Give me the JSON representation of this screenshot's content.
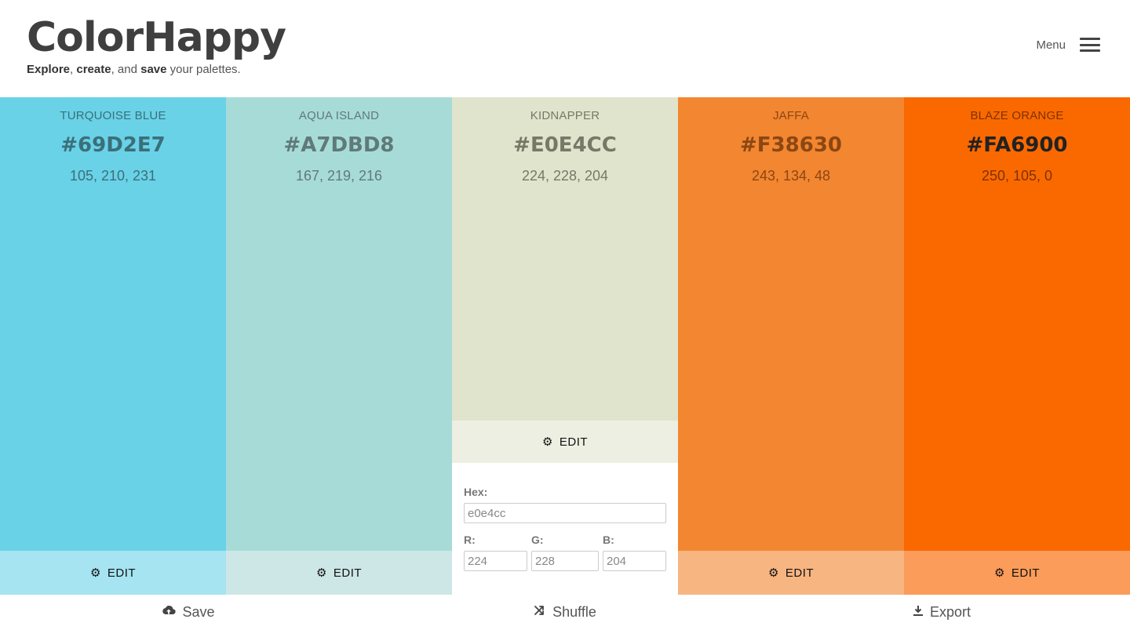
{
  "header": {
    "logo": "ColorHappy",
    "tagline": {
      "w1": "Explore",
      "s1": ", ",
      "w2": "create",
      "s2": ", and ",
      "w3": "save",
      "s3": " your palettes."
    },
    "menu_label": "Menu"
  },
  "edit_label": "EDIT",
  "palette": [
    {
      "name": "TURQUOISE BLUE",
      "hex": "#69D2E7",
      "rgb": "105, 210, 231",
      "bg": "#69D2E7",
      "edit_bg": "#A5E4F0",
      "text": "#3b6f7a",
      "hex_text": "#3b6f7a"
    },
    {
      "name": "AQUA ISLAND",
      "hex": "#A7DBD8",
      "rgb": "167, 219, 216",
      "bg": "#A7DBD8",
      "edit_bg": "#CDE7E6",
      "text": "#5f7a79",
      "hex_text": "#5f7a79"
    },
    {
      "name": "KIDNAPPER",
      "hex": "#E0E4CC",
      "rgb": "224, 228, 204",
      "bg": "#E0E4CC",
      "edit_bg": "#EDEFE2",
      "text": "#777868",
      "hex_text": "#777868"
    },
    {
      "name": "JAFFA",
      "hex": "#F38630",
      "rgb": "243, 134, 48",
      "bg": "#F38630",
      "edit_bg": "#F7B582",
      "text": "#8b4713",
      "hex_text": "#8b4713"
    },
    {
      "name": "BLAZE ORANGE",
      "hex": "#FA6900",
      "rgb": "250, 105, 0",
      "bg": "#FA6900",
      "edit_bg": "#FB9C5A",
      "text": "#7e3200",
      "hex_text": "#222222"
    }
  ],
  "editor": {
    "hex_label": "Hex:",
    "hex_value": "e0e4cc",
    "r_label": "R:",
    "r_value": "224",
    "g_label": "G:",
    "g_value": "228",
    "b_label": "B:",
    "b_value": "204"
  },
  "footer": {
    "save": "Save",
    "shuffle": "Shuffle",
    "export": "Export"
  },
  "icons": {
    "save": "cloud-upload-icon",
    "shuffle": "shuffle-icon",
    "export": "download-icon",
    "edit": "gear-icon",
    "menu": "hamburger-icon"
  }
}
